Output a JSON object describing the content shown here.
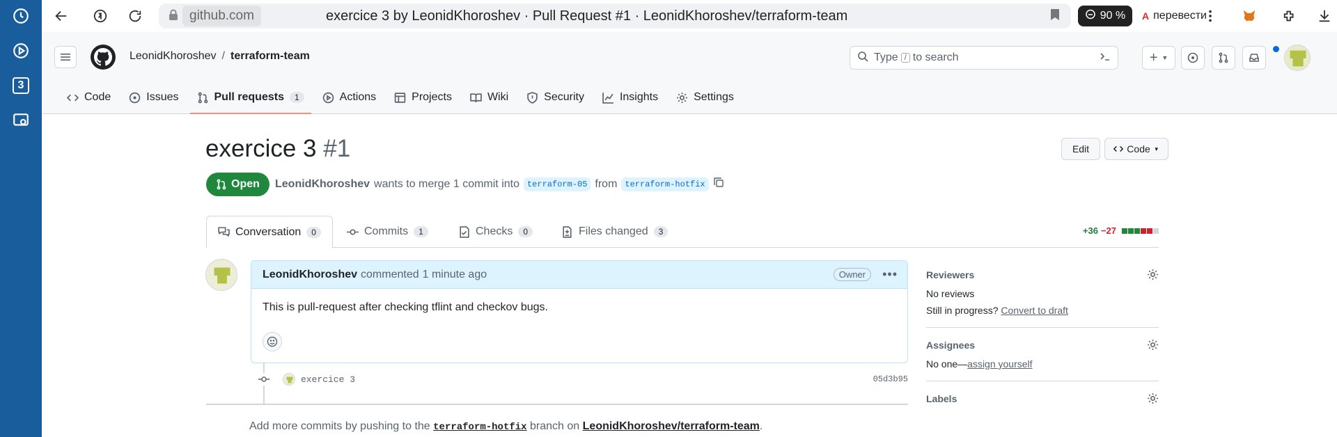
{
  "browser": {
    "domain": "github.com",
    "page_title": "exercice 3 by LeonidKhoroshev · Pull Request #1 · LeonidKhoroshev/terraform-team",
    "zoom_badge": "90 %",
    "translate_label": "перевести",
    "sidebar_number": "3"
  },
  "header": {
    "owner": "LeonidKhoroshev",
    "separator": "/",
    "repo": "terraform-team",
    "search_prefix": "Type",
    "search_key": "/",
    "search_suffix": "to search"
  },
  "repo_tabs": [
    {
      "label": "Code",
      "icon": "code-icon"
    },
    {
      "label": "Issues",
      "icon": "issue-icon"
    },
    {
      "label": "Pull requests",
      "icon": "pull-request-icon",
      "count": "1",
      "active": true
    },
    {
      "label": "Actions",
      "icon": "play-icon"
    },
    {
      "label": "Projects",
      "icon": "table-icon"
    },
    {
      "label": "Wiki",
      "icon": "book-icon"
    },
    {
      "label": "Security",
      "icon": "shield-icon"
    },
    {
      "label": "Insights",
      "icon": "graph-icon"
    },
    {
      "label": "Settings",
      "icon": "gear-icon"
    }
  ],
  "pr": {
    "title": "exercice 3",
    "number": "#1",
    "edit_label": "Edit",
    "code_label": "Code",
    "state": "Open",
    "author": "LeonidKhoroshev",
    "merge_text": "wants to merge 1 commit into",
    "base_branch": "terraform-05",
    "from_text": "from",
    "head_branch": "terraform-hotfix"
  },
  "pr_tabs": [
    {
      "label": "Conversation",
      "count": "0",
      "icon": "comment-discussion-icon",
      "active": true
    },
    {
      "label": "Commits",
      "count": "1",
      "icon": "git-commit-icon"
    },
    {
      "label": "Checks",
      "count": "0",
      "icon": "checklist-icon"
    },
    {
      "label": "Files changed",
      "count": "3",
      "icon": "file-diff-icon"
    }
  ],
  "diffstat": {
    "additions": "+36",
    "deletions": "−27"
  },
  "comment": {
    "author": "LeonidKhoroshev",
    "action": "commented",
    "time": "1 minute ago",
    "badge": "Owner",
    "body": "This is pull-request after checking tflint and checkov bugs."
  },
  "commit": {
    "message": "exercice 3",
    "sha": "05d3b95"
  },
  "footer_hint": {
    "prefix": "Add more commits by pushing to the",
    "branch": "terraform-hotfix",
    "middle": "branch on",
    "repo_link": "LeonidKhoroshev/terraform-team",
    "suffix": "."
  },
  "sidebar": {
    "reviewers_title": "Reviewers",
    "reviewers_value": "No reviews",
    "progress_text": "Still in progress?",
    "convert_link": "Convert to draft",
    "assignees_title": "Assignees",
    "assignees_value": "No one—",
    "assign_link": "assign yourself",
    "labels_title": "Labels"
  },
  "colors": {
    "accent": "#0969da",
    "open_green": "#1f883d",
    "add_green": "#1a7f37",
    "del_red": "#d1242f",
    "browser_sidebar": "#1a5d9c",
    "tab_underline": "#fd8c73"
  }
}
